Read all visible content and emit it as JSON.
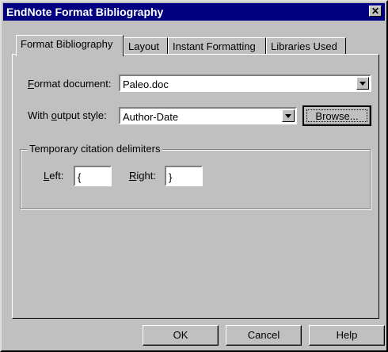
{
  "window": {
    "title": "EndNote Format Bibliography",
    "close_symbol": "✕"
  },
  "tabs": [
    {
      "label": "Format Bibliography",
      "active": true
    },
    {
      "label": "Layout"
    },
    {
      "label": "Instant Formatting"
    },
    {
      "label": "Libraries Used"
    }
  ],
  "format_document": {
    "label_mnemonic": "F",
    "label_rest": "ormat document:",
    "value": "Paleo.doc"
  },
  "output_style": {
    "label_before": "With ",
    "label_mnemonic": "o",
    "label_after": "utput style:",
    "value": "Author-Date",
    "browse_label": "Browse..."
  },
  "delimiters": {
    "group_title": "Temporary citation delimiters",
    "left_mnemonic": "L",
    "left_rest": "eft:",
    "left_value": "{",
    "right_mnemonic": "R",
    "right_rest": "ight:",
    "right_value": "}"
  },
  "buttons": {
    "ok": "OK",
    "cancel": "Cancel",
    "help": "Help"
  }
}
